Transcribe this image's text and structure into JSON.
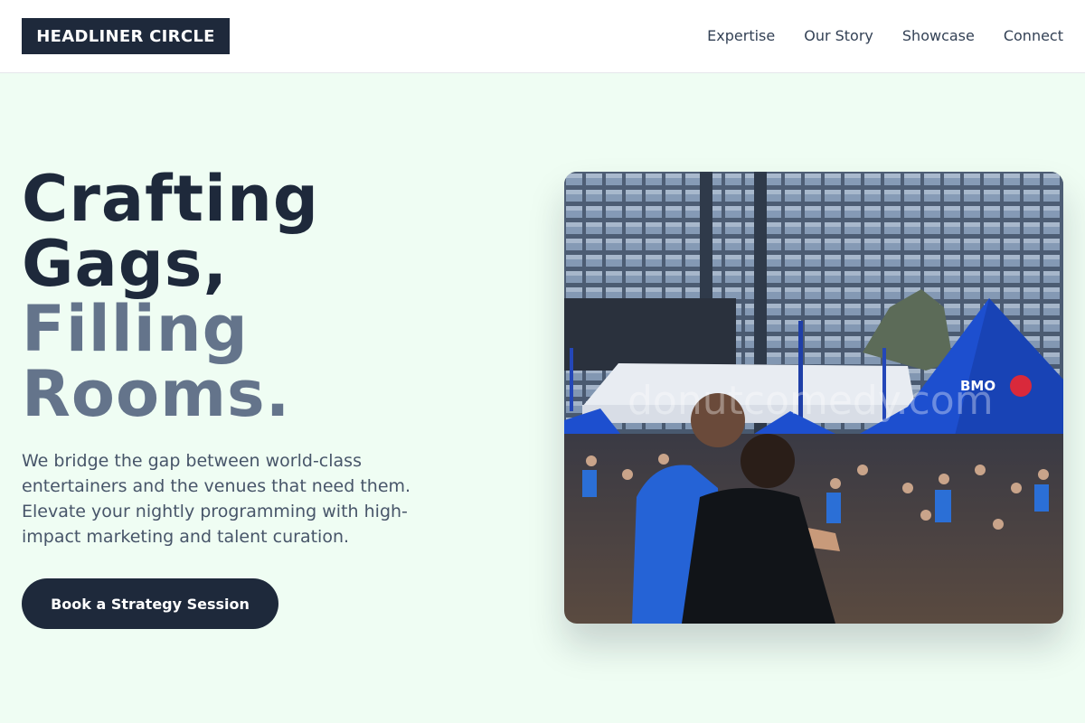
{
  "header": {
    "logo": "HEADLINER CIRCLE",
    "nav": [
      "Expertise",
      "Our Story",
      "Showcase",
      "Connect"
    ]
  },
  "hero": {
    "headline_line1": "Crafting",
    "headline_line2": "Gags,",
    "headline_line3": "Filling",
    "headline_line4": "Rooms.",
    "lead": "We bridge the gap between world-class entertainers and the venues that need them. Elevate your nightly programming with high-impact marketing and talent curation.",
    "cta": "Book a Strategy Session",
    "image": {
      "tent_text": "BMO",
      "watermark": "donutcomedy.com"
    }
  },
  "colors": {
    "background": "#effdf3",
    "navy": "#1e293b",
    "slate": "#64748b",
    "tent_blue": "#1d4fcf"
  }
}
